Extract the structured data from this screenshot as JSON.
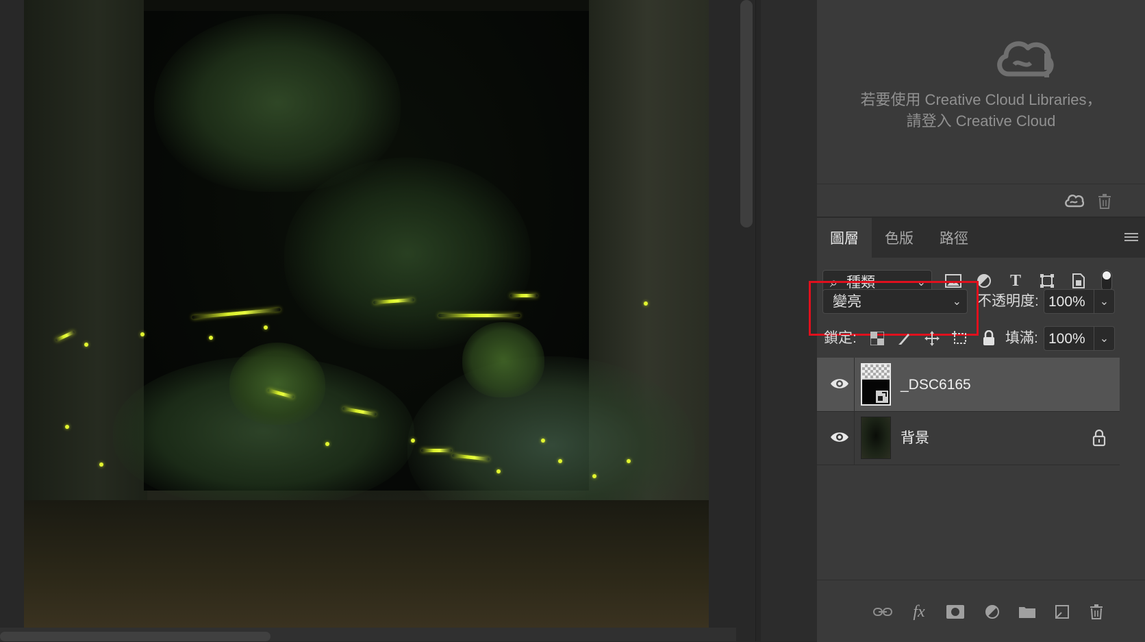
{
  "canvas": {
    "image_alt": "Night forest photo with firefly trails through stone doorway"
  },
  "libraries": {
    "message_line1": "若要使用 Creative Cloud Libraries，",
    "message_line2": "請登入 Creative Cloud",
    "icons": [
      "creative-cloud-icon",
      "trash-icon"
    ]
  },
  "layers_panel": {
    "tabs": [
      {
        "label": "圖層",
        "active": true
      },
      {
        "label": "色版",
        "active": false
      },
      {
        "label": "路徑",
        "active": false
      }
    ],
    "filter": {
      "label": "種類",
      "icons": [
        "image-filter-icon",
        "adjustment-filter-icon",
        "text-filter-icon",
        "shape-filter-icon",
        "smart-object-filter-icon"
      ]
    },
    "blend_mode": "變亮",
    "opacity_label": "不透明度:",
    "opacity_value": "100%",
    "lock_label": "鎖定:",
    "fill_label": "填滿:",
    "fill_value": "100%",
    "layers": [
      {
        "name": "_DSC6165",
        "visible": true,
        "selected": true,
        "locked": false
      },
      {
        "name": "背景",
        "visible": true,
        "selected": false,
        "locked": true
      }
    ],
    "bottom_icons": [
      "link-icon",
      "fx-icon",
      "mask-icon",
      "adjustment-icon",
      "folder-icon",
      "new-layer-icon",
      "trash-icon"
    ],
    "highlight_color": "#e0101d"
  }
}
